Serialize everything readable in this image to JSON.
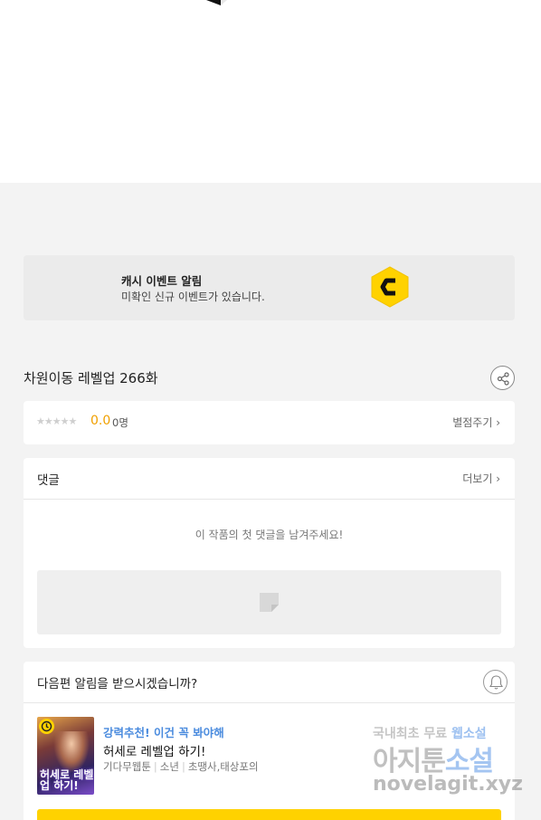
{
  "event": {
    "title": "캐시 이벤트 알림",
    "description": "미확인 신규 이벤트가 있습니다.",
    "coin_letter": "C",
    "coin_color": "#ffd200"
  },
  "episode": {
    "title": "차원이동 레벨업 266화"
  },
  "rating": {
    "stars": "★★★★★",
    "score": "0.0",
    "count": "0명",
    "rate_link": "별점주기 ›"
  },
  "comments": {
    "title": "댓글",
    "more_link": "더보기 ›",
    "empty_text": "이 작품의 첫 댓글을 남겨주세요!"
  },
  "notify": {
    "title": "다음편 알림을 받으시겠습니까?"
  },
  "recommendation": {
    "tagline": "강력추천! 이건 꼭 봐야해",
    "title": "허세로 레벨업 하기!",
    "meta": [
      "기다무웹툰",
      "소년",
      "초땡사,태상포의"
    ],
    "thumb_title": "허세로 레벨업 하기!",
    "tagline_color": "#4a8bde"
  },
  "watermark": {
    "line1_a": "국내최초 무료 ",
    "line1_b": "웹소설",
    "line2_a": "아지툰",
    "line2_b": "소설",
    "line3": "novelagit.xyz"
  },
  "colors": {
    "accent": "#ffd200",
    "rating": "#f0a000"
  }
}
